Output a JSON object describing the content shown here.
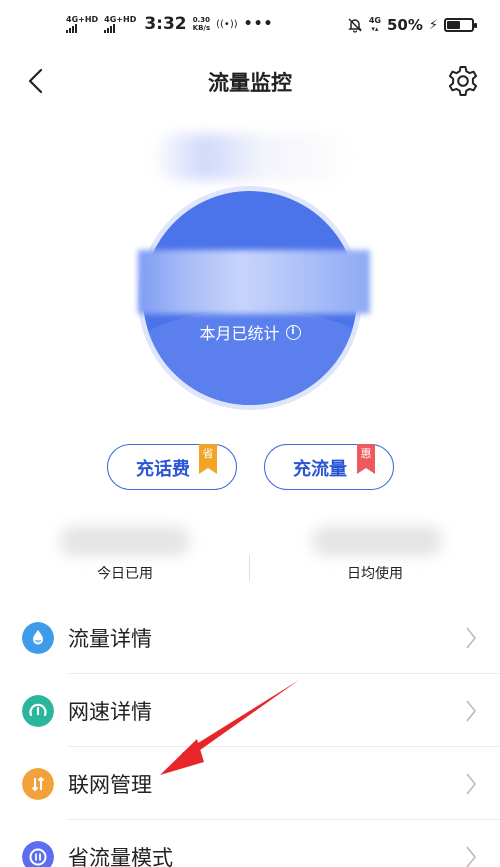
{
  "status_bar": {
    "sim1": "4G+HD",
    "sim2": "4G+HD",
    "time": "3:32",
    "speed_value": "0.30",
    "speed_unit": "KB/s",
    "hotspot": "((•))",
    "more": "•••",
    "network": "4G",
    "battery": "50%"
  },
  "header": {
    "title": "流量监控"
  },
  "usage": {
    "circle_label": "本月已统计",
    "info_symbol": "i"
  },
  "actions": {
    "recharge_call_label": "充话费",
    "recharge_call_badge": "省",
    "recharge_data_label": "充流量",
    "recharge_data_badge": "惠"
  },
  "stats": {
    "today_label": "今日已用",
    "daily_avg_label": "日均使用"
  },
  "menu": [
    {
      "label": "流量详情",
      "icon": "water-drop-icon",
      "color": "#3d9bea"
    },
    {
      "label": "网速详情",
      "icon": "speedometer-icon",
      "color": "#2bb59a"
    },
    {
      "label": "联网管理",
      "icon": "transfer-arrows-icon",
      "color": "#f2a23a"
    },
    {
      "label": "省流量模式",
      "icon": "save-data-icon",
      "color": "#5b6ef0"
    }
  ],
  "colors": {
    "primary_blue": "#4c74ea",
    "accent_orange": "#f2a428",
    "accent_red": "#ec5a5e",
    "annotation_arrow": "#e8262a"
  }
}
